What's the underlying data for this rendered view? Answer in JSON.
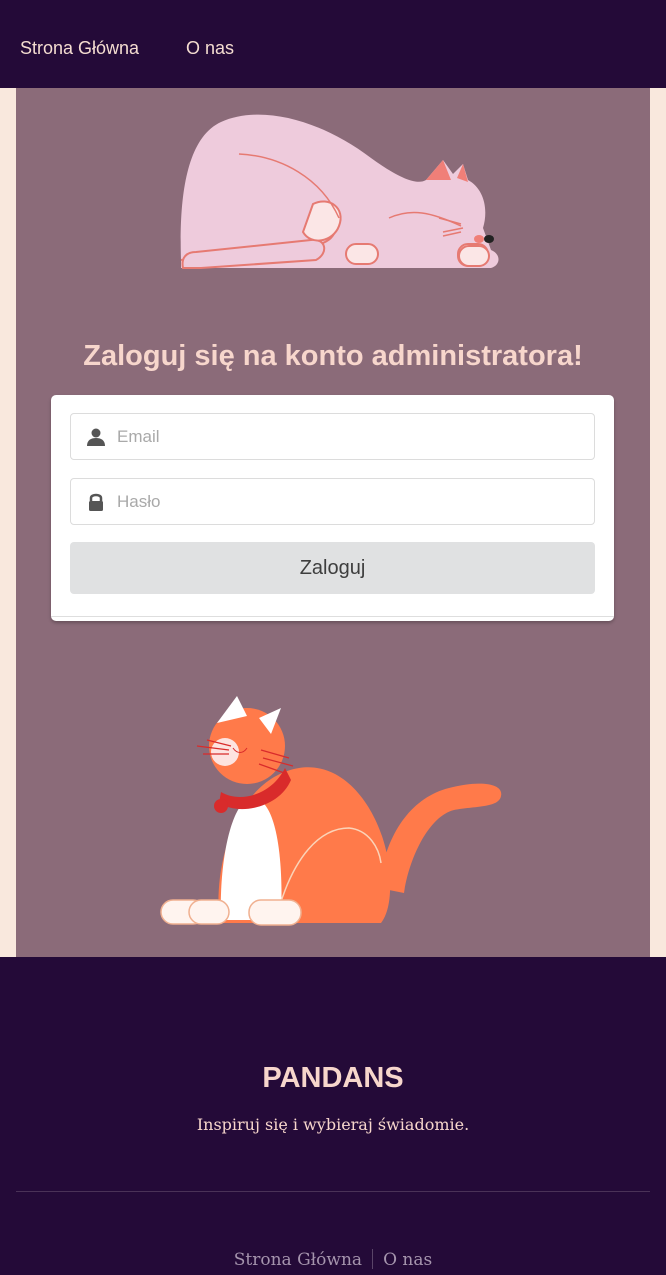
{
  "nav": {
    "home_label": "Strona Główna",
    "about_label": "O nas"
  },
  "login": {
    "title": "Zaloguj się na konto administratora!",
    "email_placeholder": "Email",
    "password_placeholder": "Hasło",
    "submit_label": "Zaloguj"
  },
  "footer": {
    "brand": "PANDANS",
    "tagline": "Inspiruj się i wybieraj świadomie.",
    "links": [
      "Strona Główna",
      "O nas"
    ]
  },
  "icons": {
    "email_field": "user-icon",
    "password_field": "lock-icon"
  },
  "colors": {
    "nav_bg": "#240a38",
    "main_bg": "#8b6b79",
    "page_bg": "#f9e8dd",
    "accent_text": "#f7d6cc",
    "button_bg": "#e0e1e2"
  }
}
